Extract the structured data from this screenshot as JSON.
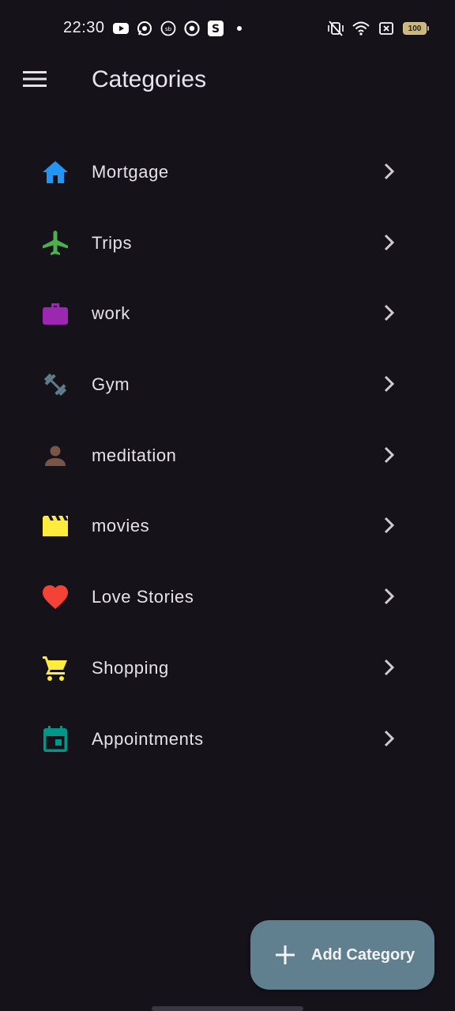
{
  "status_bar": {
    "time": "22:30",
    "left_icons": [
      "youtube-icon",
      "whatsapp-icon",
      "sb-app-icon",
      "chrome-icon",
      "s-app-icon",
      "notification-dot-icon"
    ],
    "right_icons": [
      "vibrate-off-icon",
      "wifi-icon",
      "sim-off-icon",
      "battery-icon"
    ],
    "battery": "100"
  },
  "app_bar": {
    "menu_icon": "hamburger-menu-icon",
    "title": "Categories"
  },
  "categories": [
    {
      "label": "Mortgage",
      "icon": "home-icon",
      "color": "#2196f3"
    },
    {
      "label": "Trips",
      "icon": "airplane-icon",
      "color": "#4caf50"
    },
    {
      "label": "work",
      "icon": "briefcase-icon",
      "color": "#9c27b0"
    },
    {
      "label": "Gym",
      "icon": "dumbbell-icon",
      "color": "#607d8b"
    },
    {
      "label": "meditation",
      "icon": "person-icon",
      "color": "#795548"
    },
    {
      "label": "movies",
      "icon": "movie-clapper-icon",
      "color": "#ffeb3b"
    },
    {
      "label": "Love Stories",
      "icon": "heart-icon",
      "color": "#f44336"
    },
    {
      "label": "Shopping",
      "icon": "shopping-cart-icon",
      "color": "#ffeb3b"
    },
    {
      "label": "Appointments",
      "icon": "calendar-event-icon",
      "color": "#009688"
    }
  ],
  "fab": {
    "label": "Add Category",
    "icon": "plus-icon",
    "color": "#60808f"
  }
}
